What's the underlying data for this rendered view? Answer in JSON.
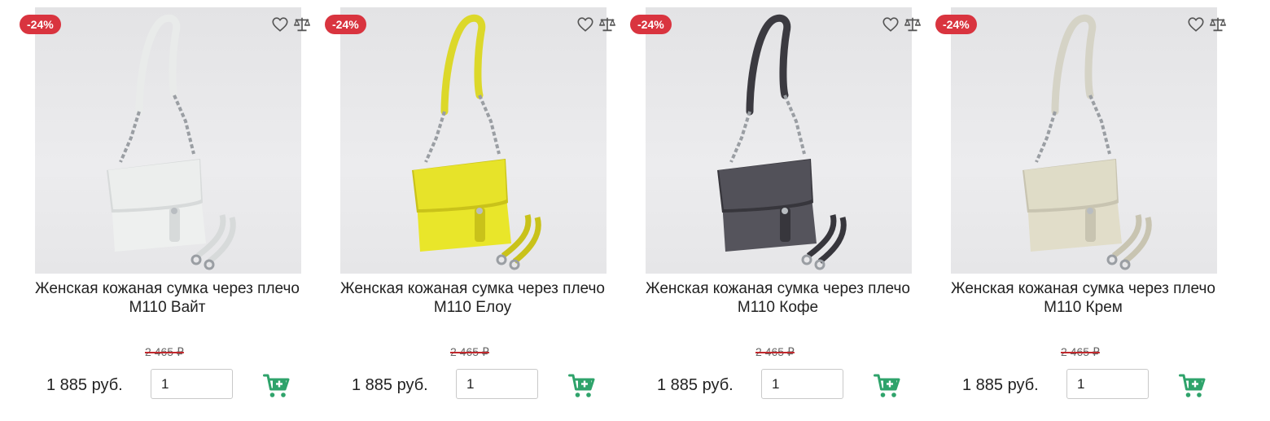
{
  "theme": {
    "badge_color": "#d9343f",
    "cart_color": "#2fa36b",
    "strike_color": "#c0282d"
  },
  "products": [
    {
      "discount": "-24%",
      "title_line1": "Женская кожаная сумка через плечо",
      "title_line2": "M110 Вайт",
      "old_price": "2 465 ₽",
      "price": "1 885 руб.",
      "quantity": "1",
      "bag_color": "#eef0ef",
      "bag_shade": "#d7dada",
      "handle_color": "#e9ebea"
    },
    {
      "discount": "-24%",
      "title_line1": "Женская кожаная сумка через плечо",
      "title_line2": "M110 Елоу",
      "old_price": "2 465 ₽",
      "price": "1 885 руб.",
      "quantity": "1",
      "bag_color": "#e9e62a",
      "bag_shade": "#c9c21a",
      "handle_color": "#dcd82a"
    },
    {
      "discount": "-24%",
      "title_line1": "Женская кожаная сумка через плечо",
      "title_line2": "M110 Кофе",
      "old_price": "2 465 ₽",
      "price": "1 885 руб.",
      "quantity": "1",
      "bag_color": "#55545c",
      "bag_shade": "#37363c",
      "handle_color": "#3b3a40"
    },
    {
      "discount": "-24%",
      "title_line1": "Женская кожаная сумка через плечо",
      "title_line2": "M110 Крем",
      "old_price": "2 465 ₽",
      "price": "1 885 руб.",
      "quantity": "1",
      "bag_color": "#e1ddc9",
      "bag_shade": "#c8c4b1",
      "handle_color": "#d5d3c6"
    }
  ]
}
